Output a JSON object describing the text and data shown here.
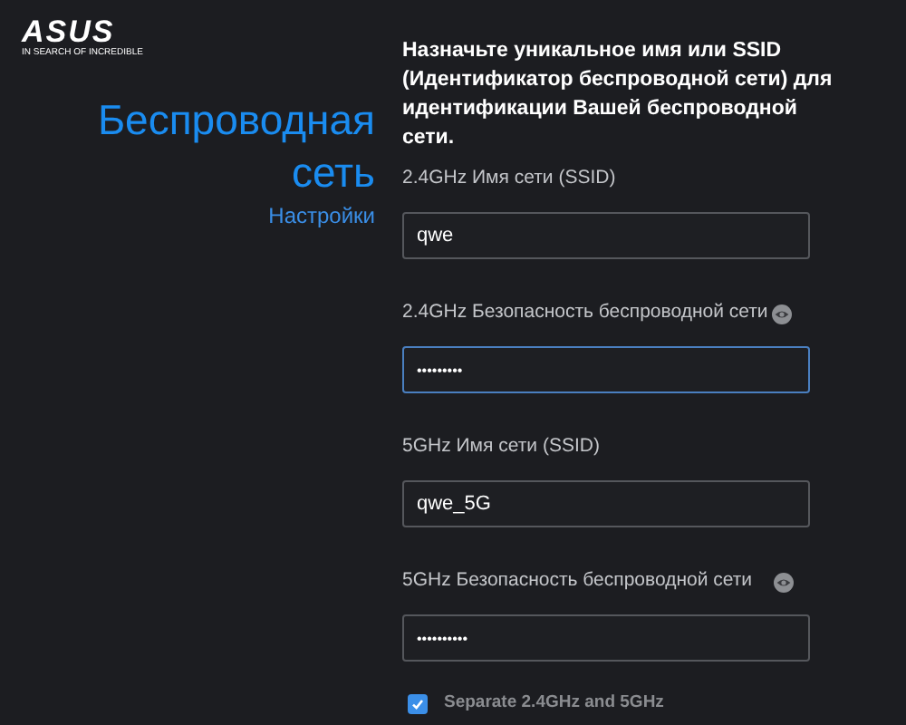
{
  "logo": {
    "wordmark": "ASUS",
    "tagline": "IN SEARCH OF INCREDIBLE"
  },
  "title": "Беспроводная сеть",
  "subtitle": "Настройки",
  "description": "Назначьте уникальное имя или SSID (Идентификатор беспроводной сети) для идентификации Вашей беспроводной сети.",
  "fields": [
    {
      "label": "2.4GHz Имя сети (SSID)",
      "value": "qwe",
      "kind": "text",
      "focused": false
    },
    {
      "label": "2.4GHz Безопасность беспроводной сети",
      "value": "•••••••••",
      "kind": "password",
      "focused": true
    },
    {
      "label": "5GHz Имя сети (SSID)",
      "value": "qwe_5G",
      "kind": "text",
      "focused": false
    },
    {
      "label": "5GHz Безопасность беспроводной сети",
      "value": "••••••••••",
      "kind": "password",
      "focused": false
    }
  ],
  "separate": {
    "label": "Separate 2.4GHz and 5GHz",
    "checked": true
  }
}
